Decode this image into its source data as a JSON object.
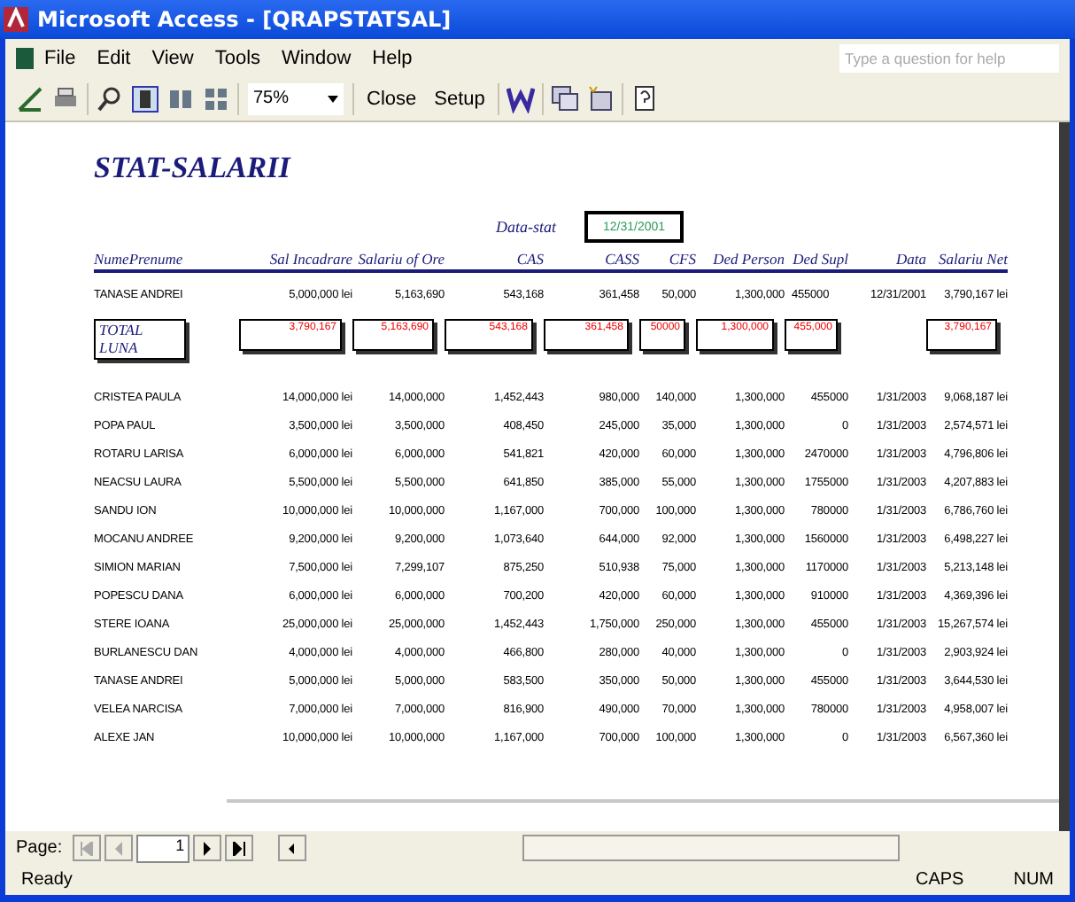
{
  "window": {
    "title": "Microsoft Access - [QRAPSTATSAL]"
  },
  "menu": [
    "File",
    "Edit",
    "View",
    "Tools",
    "Window",
    "Help"
  ],
  "help_box": {
    "placeholder": "Type a question for help"
  },
  "toolbar": {
    "zoom": "75%",
    "buttons": [
      "Close",
      "Setup"
    ]
  },
  "report": {
    "title": "STAT-SALARII",
    "date_label": "Data-stat",
    "date_value": "12/31/2001",
    "columns": [
      "NumePrenume",
      "Sal Incadrare",
      "Salariu of Ore",
      "CAS",
      "CASS",
      "CFS",
      "Ded Person",
      "Ded Supl",
      "Data",
      "Salariu Net"
    ],
    "first_row": [
      "TANASE ANDREI",
      "5,000,000 lei",
      "5,163,690",
      "543,168",
      "361,458",
      "50,000",
      "1,300,000",
      "455000",
      "12/31/2001",
      "3,790,167 lei"
    ],
    "total": {
      "label": "TOTAL LUNA",
      "values": [
        "3,790,167",
        "5,163,690",
        "543,168",
        "361,458",
        "50000",
        "1,300,000",
        "455,000"
      ],
      "net_value": "3,790,167"
    },
    "rows": [
      [
        "CRISTEA PAULA",
        "14,000,000 lei",
        "14,000,000",
        "1,452,443",
        "980,000",
        "140,000",
        "1,300,000",
        "455000",
        "1/31/2003",
        "9,068,187 lei"
      ],
      [
        "POPA PAUL",
        "3,500,000 lei",
        "3,500,000",
        "408,450",
        "245,000",
        "35,000",
        "1,300,000",
        "0",
        "1/31/2003",
        "2,574,571 lei"
      ],
      [
        "ROTARU LARISA",
        "6,000,000 lei",
        "6,000,000",
        "541,821",
        "420,000",
        "60,000",
        "1,300,000",
        "2470000",
        "1/31/2003",
        "4,796,806 lei"
      ],
      [
        "NEACSU LAURA",
        "5,500,000 lei",
        "5,500,000",
        "641,850",
        "385,000",
        "55,000",
        "1,300,000",
        "1755000",
        "1/31/2003",
        "4,207,883 lei"
      ],
      [
        "SANDU ION",
        "10,000,000 lei",
        "10,000,000",
        "1,167,000",
        "700,000",
        "100,000",
        "1,300,000",
        "780000",
        "1/31/2003",
        "6,786,760 lei"
      ],
      [
        "MOCANU ANDREE",
        "9,200,000 lei",
        "9,200,000",
        "1,073,640",
        "644,000",
        "92,000",
        "1,300,000",
        "1560000",
        "1/31/2003",
        "6,498,227 lei"
      ],
      [
        "SIMION MARIAN",
        "7,500,000 lei",
        "7,299,107",
        "875,250",
        "510,938",
        "75,000",
        "1,300,000",
        "1170000",
        "1/31/2003",
        "5,213,148 lei"
      ],
      [
        "POPESCU DANA",
        "6,000,000 lei",
        "6,000,000",
        "700,200",
        "420,000",
        "60,000",
        "1,300,000",
        "910000",
        "1/31/2003",
        "4,369,396 lei"
      ],
      [
        "STERE IOANA",
        "25,000,000 lei",
        "25,000,000",
        "1,452,443",
        "1,750,000",
        "250,000",
        "1,300,000",
        "455000",
        "1/31/2003",
        "15,267,574 lei"
      ],
      [
        "BURLANESCU DAN",
        "4,000,000 lei",
        "4,000,000",
        "466,800",
        "280,000",
        "40,000",
        "1,300,000",
        "0",
        "1/31/2003",
        "2,903,924 lei"
      ],
      [
        "TANASE ANDREI",
        "5,000,000 lei",
        "5,000,000",
        "583,500",
        "350,000",
        "50,000",
        "1,300,000",
        "455000",
        "1/31/2003",
        "3,644,530 lei"
      ],
      [
        "VELEA NARCISA",
        "7,000,000 lei",
        "7,000,000",
        "816,900",
        "490,000",
        "70,000",
        "1,300,000",
        "780000",
        "1/31/2003",
        "4,958,007 lei"
      ],
      [
        "ALEXE JAN",
        "10,000,000 lei",
        "10,000,000",
        "1,167,000",
        "700,000",
        "100,000",
        "1,300,000",
        "0",
        "1/31/2003",
        "6,567,360 lei"
      ]
    ]
  },
  "navigation": {
    "label": "Page:",
    "page": "1"
  },
  "status_bar": {
    "text": "Ready",
    "indicators": [
      "CAPS",
      "NUM"
    ]
  }
}
